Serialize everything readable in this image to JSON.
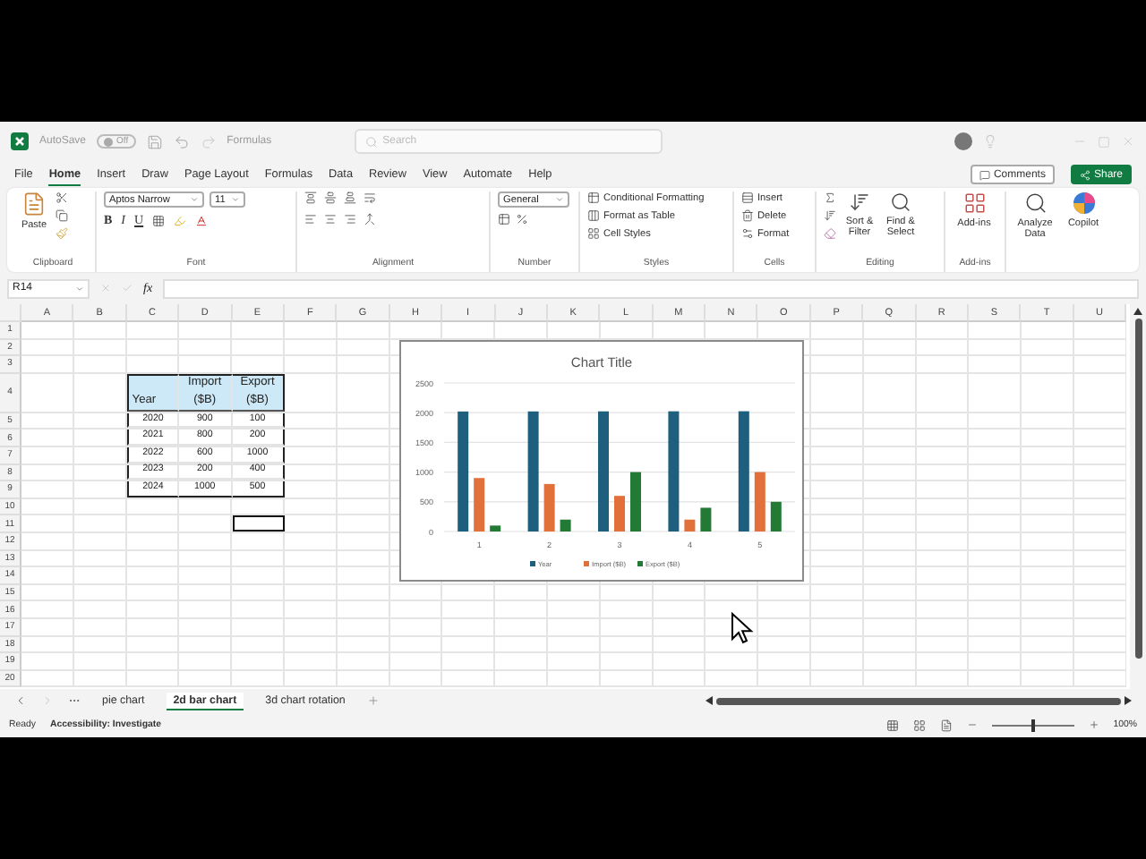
{
  "title_bar": {
    "autosave_label": "AutoSave",
    "autosave_state": "Off",
    "autosave_on": false,
    "file_name": "Formulas",
    "search_placeholder": "Search"
  },
  "menu": [
    {
      "label": "File",
      "selected": false
    },
    {
      "label": "Home",
      "selected": true
    },
    {
      "label": "Insert",
      "selected": false
    },
    {
      "label": "Draw",
      "selected": false
    },
    {
      "label": "Page Layout",
      "selected": false
    },
    {
      "label": "Formulas",
      "selected": false
    },
    {
      "label": "Data",
      "selected": false
    },
    {
      "label": "Review",
      "selected": false
    },
    {
      "label": "View",
      "selected": false
    },
    {
      "label": "Automate",
      "selected": false
    },
    {
      "label": "Help",
      "selected": false
    }
  ],
  "comments_button": "Comments",
  "share_button": "Share",
  "ribbon": {
    "clipboard": {
      "paste": "Paste",
      "label": "Clipboard"
    },
    "font": {
      "name": "Aptos Narrow",
      "size": "11",
      "bold": "B",
      "italic": "I",
      "underline": "U",
      "label": "Font"
    },
    "alignment": {
      "label": "Alignment"
    },
    "number": {
      "format": "General",
      "label": "Number"
    },
    "styles": {
      "items": [
        "Conditional Formatting",
        "Format as Table",
        "Cell Styles"
      ],
      "label": "Styles"
    },
    "cells": {
      "items": [
        "Insert",
        "Delete",
        "Format"
      ],
      "label": "Cells"
    },
    "editing": {
      "items": [
        "Sort & Filter",
        "Find & Select"
      ],
      "label": "Editing"
    },
    "addins": {
      "items": [
        "Add-ins"
      ],
      "label": "Add-ins"
    },
    "extra": [
      "Analyze Data",
      "Copilot"
    ]
  },
  "formula_bar": {
    "name_box": "R14",
    "function_label": "fx"
  },
  "sheet": {
    "columns": [
      "A",
      "B",
      "C",
      "D",
      "E",
      "F",
      "G",
      "H",
      "I",
      "J",
      "K",
      "L",
      "M",
      "N",
      "O",
      "P",
      "Q",
      "R",
      "S",
      "T",
      "U"
    ],
    "rows": [
      "1",
      "2",
      "3",
      "4",
      "5",
      "6",
      "7",
      "8",
      "9",
      "10",
      "11",
      "12",
      "13",
      "14",
      "15",
      "16",
      "17",
      "18",
      "19",
      "20"
    ],
    "table": {
      "headers": [
        "Year",
        "Import ($B)",
        "Export ($B)"
      ],
      "rows": [
        [
          "2020",
          "900",
          "100"
        ],
        [
          "2021",
          "800",
          "200"
        ],
        [
          "2022",
          "600",
          "1000"
        ],
        [
          "2023",
          "200",
          "400"
        ],
        [
          "2024",
          "1000",
          "500"
        ]
      ]
    }
  },
  "chart": {
    "chart_data": {
      "type": "bar",
      "title": "Chart Title",
      "categories": [
        "1",
        "2",
        "3",
        "4",
        "5"
      ],
      "series": [
        {
          "name": "Year",
          "color": "#1f5f7e",
          "values": [
            2020,
            2021,
            2022,
            2023,
            2024
          ]
        },
        {
          "name": "Import ($B)",
          "color": "#e2703a",
          "values": [
            900,
            800,
            600,
            200,
            1000
          ]
        },
        {
          "name": "Export ($B)",
          "color": "#237a35",
          "values": [
            100,
            200,
            1000,
            400,
            500
          ]
        }
      ],
      "ylim": [
        0,
        2500
      ],
      "yticks": [
        0,
        500,
        1000,
        1500,
        2000,
        2500
      ],
      "grid": true,
      "legend": "bottom"
    }
  },
  "sheet_tabs": [
    {
      "label": "pie chart",
      "selected": false
    },
    {
      "label": "2d bar chart",
      "selected": true
    },
    {
      "label": "3d  chart rotation",
      "selected": false
    }
  ],
  "status_bar": {
    "state": "Ready",
    "accessibility": "Accessibility: Investigate",
    "zoom": "100%",
    "zoom_slider": {
      "level": 0.5
    }
  }
}
